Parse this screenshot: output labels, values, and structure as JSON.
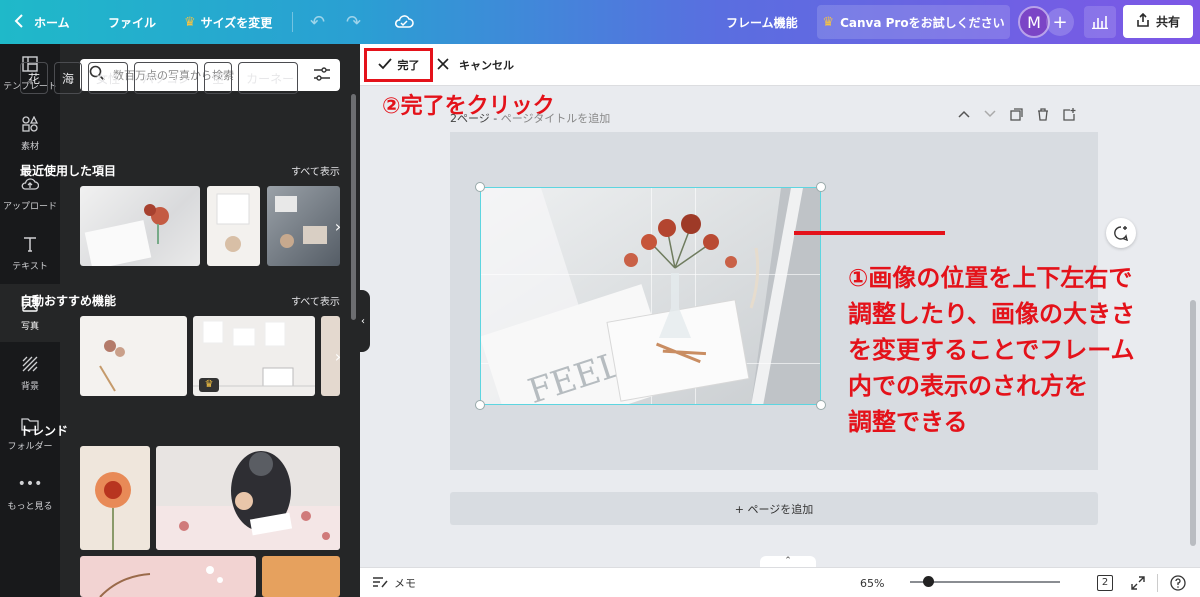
{
  "topbar": {
    "home_label": "ホーム",
    "file_label": "ファイル",
    "resize_label": "サイズを変更",
    "frame_label": "フレーム機能",
    "pro_label": "Canva Proをお試しください",
    "avatar_initial": "M",
    "share_label": "共有",
    "accent_color": "#7d57e6"
  },
  "rail": {
    "items": [
      {
        "label": "テンプレート",
        "icon": "template-icon"
      },
      {
        "label": "素材",
        "icon": "elements-icon"
      },
      {
        "label": "アップロード",
        "icon": "upload-icon"
      },
      {
        "label": "テキスト",
        "icon": "text-icon"
      },
      {
        "label": "写真",
        "icon": "photo-icon"
      },
      {
        "label": "背景",
        "icon": "background-icon"
      },
      {
        "label": "フォルダー",
        "icon": "folder-icon"
      },
      {
        "label": "もっと見る",
        "icon": "more-icon"
      }
    ],
    "active": "写真"
  },
  "panel": {
    "search_placeholder": "数百万点の写真から検索",
    "chips": [
      "花",
      "海",
      "女性",
      "パソコン",
      "空",
      "カーネー"
    ],
    "recent_title": "最近使用した項目",
    "auto_title": "自動おすすめ機能",
    "trend_title": "トレンド",
    "see_all": "すべて表示"
  },
  "editor": {
    "done_label": "完了",
    "cancel_label": "キャンセル",
    "step2_text": "②完了をクリック",
    "page_label": "2ページ - ",
    "page_title_placeholder": "ページタイトルを追加",
    "annotation_lines": [
      "①画像の位置を上下左右で",
      "調整したり、画像の大きさ",
      "を変更することでフレーム",
      "内での表示のされ方を",
      "調整できる"
    ],
    "add_page_label": "+ ページを追加",
    "annotation_color": "#e4121a"
  },
  "bottom": {
    "notes_label": "メモ",
    "zoom_value": "65%",
    "page_count": "2"
  }
}
